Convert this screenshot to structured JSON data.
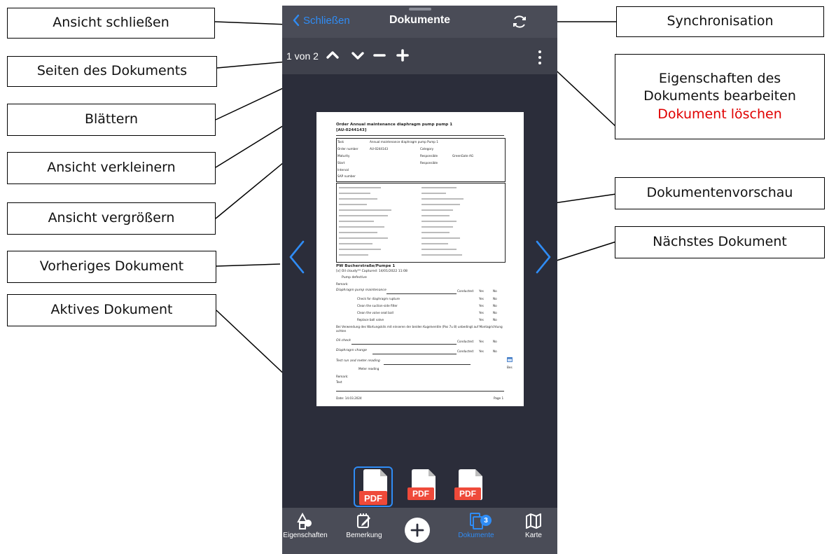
{
  "annotations": {
    "close_view": "Ansicht schließen",
    "sync": "Synchronisation",
    "pages": "Seiten des Dokuments",
    "properties_line1": "Eigenschaften des",
    "properties_line2": "Dokuments bearbeiten",
    "delete": "Dokument löschen",
    "browse": "Blättern",
    "zoom_out": "Ansicht verkleinern",
    "preview": "Dokumentenvorschau",
    "zoom_in": "Ansicht vergrößern",
    "next": "Nächstes Dokument",
    "previous": "Vorheriges Dokument",
    "active": "Aktives Dokument"
  },
  "header": {
    "back_label": "Schließen",
    "title": "Dokumente"
  },
  "toolbar": {
    "page_count": "1 von 2"
  },
  "document": {
    "title_line1": "Order Annual maintenance diaphragm pump pump 1",
    "title_line2": "[AU-0244143]",
    "fields": [
      {
        "k": "Task",
        "v": "Annual maintenance diaphragm pump Pump 1"
      },
      {
        "k": "Order number",
        "v": "AU-0244143"
      },
      {
        "k": "Maturity",
        "v": ""
      },
      {
        "k": "Start",
        "v": ""
      },
      {
        "k": "Interval",
        "v": ""
      },
      {
        "k": "SAP number",
        "v": ""
      }
    ],
    "right_fields": [
      {
        "k": "Category",
        "v": ""
      },
      {
        "k": "Responsible",
        "v": "GreenGate AG"
      },
      {
        "k": "Responsible",
        "v": ""
      }
    ],
    "section": "PW Bucherstraße/Pumpe 1",
    "checked": "[x] Oil cloudy**  Captured: 14/01/2022 11:08",
    "pump_defective": "Pump defective",
    "remark_label": "Remark:",
    "item_maint": "Diaphragm pump maintenance",
    "item_rupture": "Check for diaphragm rupture",
    "item_filter": "Clean the suction-side filter",
    "item_valve": "Clean the valve seat ball",
    "item_replace": "Replace ball valve",
    "note": "Bei Verwendung des Wartungskits mit einseren der beiden Kugelventile (Pos 7u 8) unbedingt auf Montagrichtung achten",
    "item_oil": "Oil check",
    "item_diaphragm": "Diaphragm change",
    "item_test": "Test run and meter reading",
    "meter": "Meter reading",
    "unit": "Bes",
    "conducted": "Conducted:",
    "yes": "Yes",
    "no": "No",
    "remark2": "Remark:",
    "text": "Text",
    "footer_date": "Date: 14.03.2024",
    "footer_page": "Page 1"
  },
  "thumbnails": [
    "PDF",
    "PDF",
    "PDF"
  ],
  "tabs": {
    "properties": "Eigenschaften",
    "remark": "Bemerkung",
    "documents": "Dokumente",
    "documents_badge": "3",
    "map": "Karte"
  },
  "colors": {
    "accent": "#2f8cf5",
    "pdf": "#ef4a3a",
    "delete": "#e00000"
  }
}
